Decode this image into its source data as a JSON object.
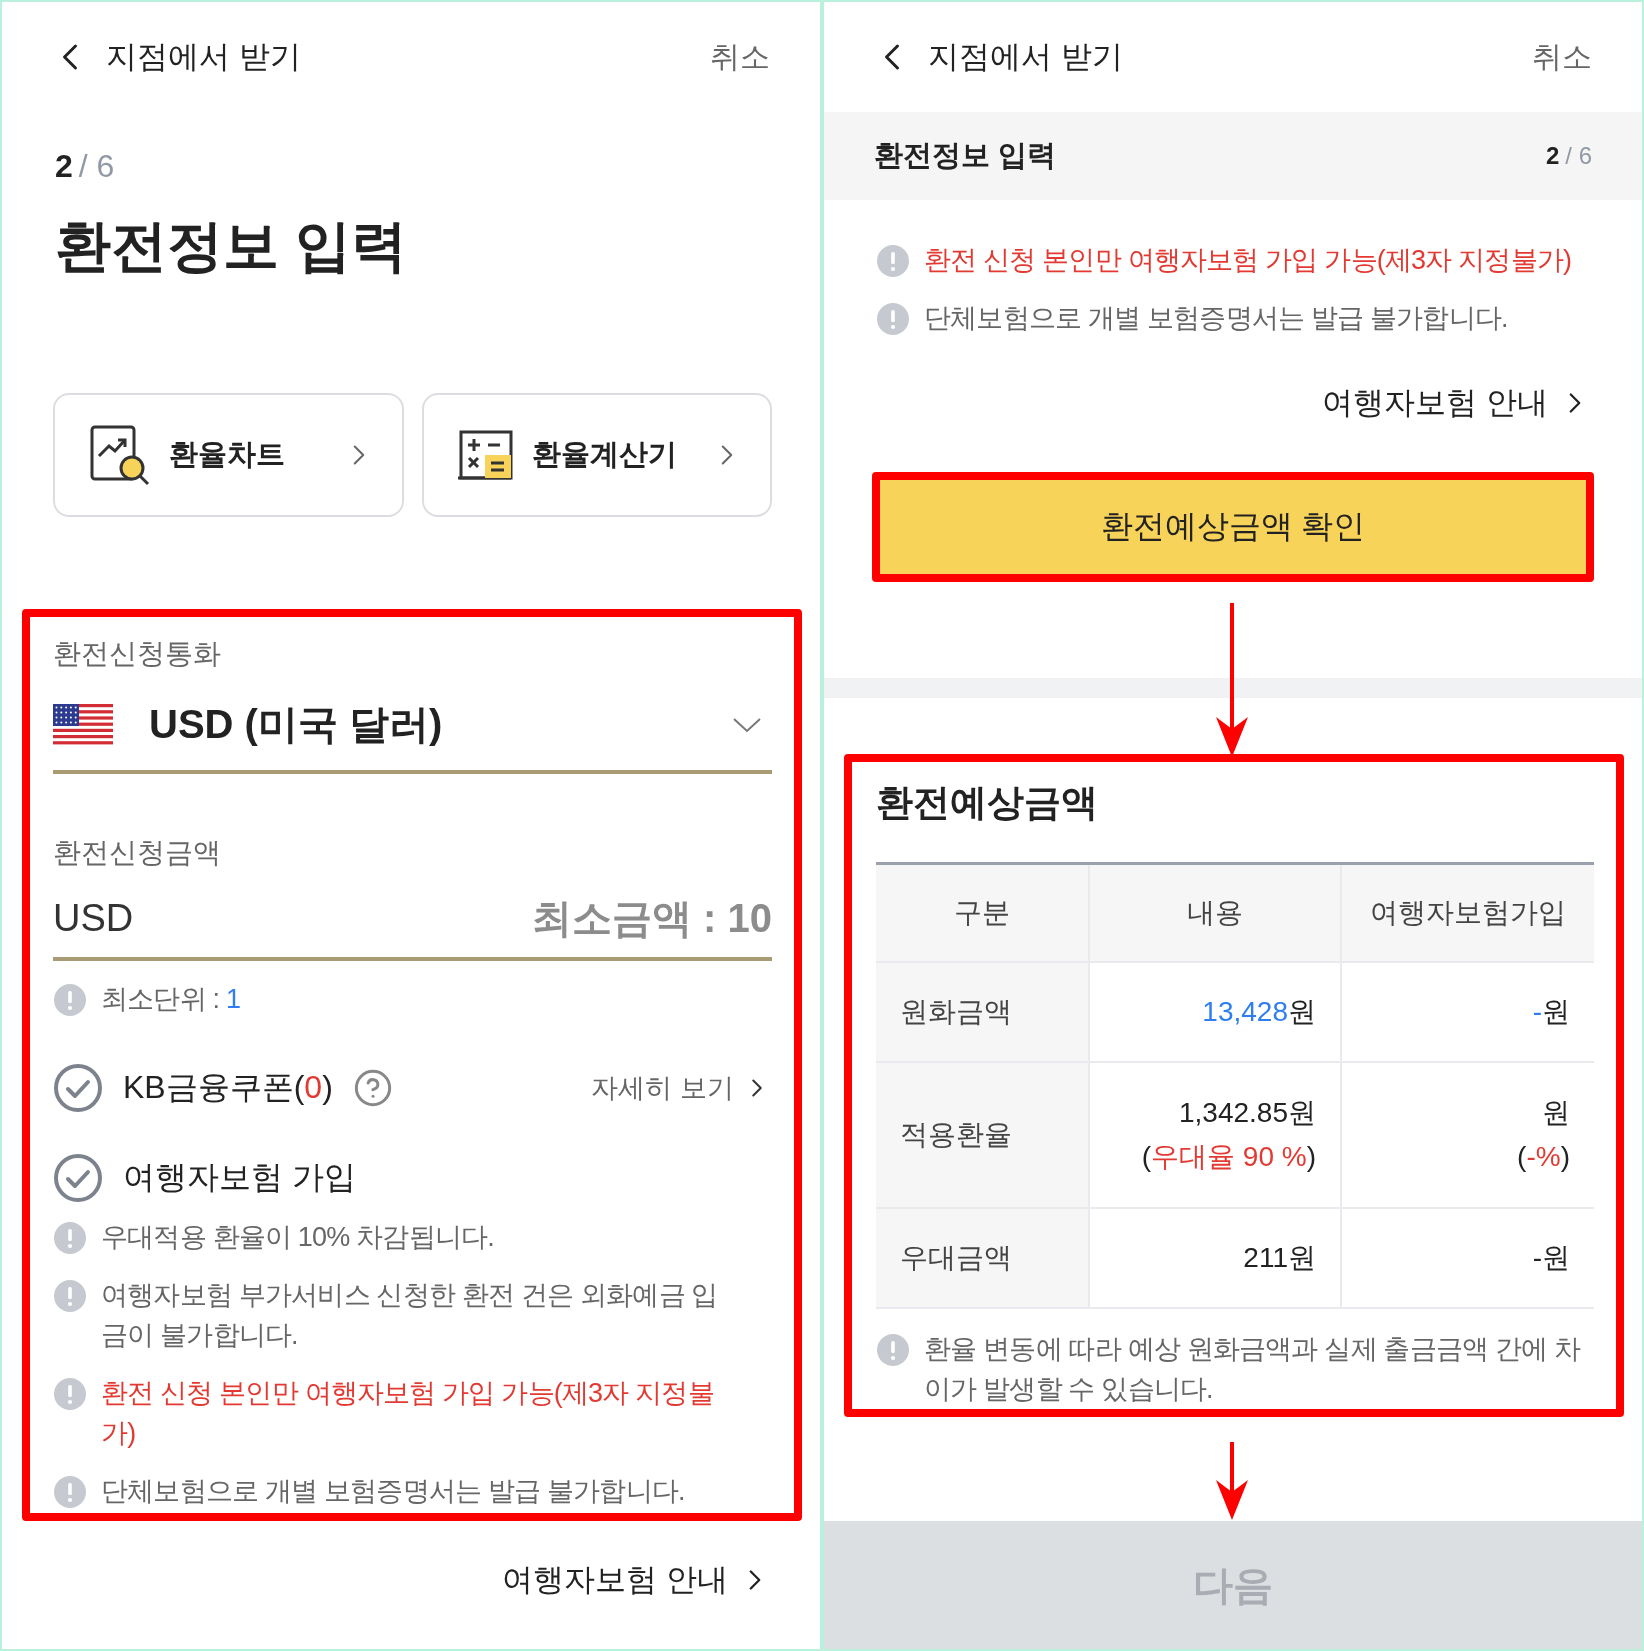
{
  "left_screen": {
    "header": {
      "title": "지점에서 받기",
      "cancel": "취소"
    },
    "step": {
      "current": "2",
      "total": "/ 6"
    },
    "title": "환전정보 입력",
    "shortcuts": [
      {
        "label": "환율차트",
        "kind": "chart"
      },
      {
        "label": "환율계산기",
        "kind": "calculator"
      }
    ],
    "currency": {
      "label": "환전신청통화",
      "value": "USD (미국 달러)"
    },
    "amount": {
      "label": "환전신청금액",
      "unit": "USD",
      "placeholder": "최소금액 : 10"
    },
    "min_unit": {
      "label": "최소단위 : ",
      "value": "1"
    },
    "coupon": {
      "label": "KB금융쿠폰(",
      "count": "0",
      "close": ")",
      "checked": false,
      "details": "자세히 보기"
    },
    "insurance": {
      "label": "여행자보험 가입",
      "checked": false
    },
    "notes": [
      {
        "text": "우대적용 환율이 10% 차감됩니다.",
        "kind": "plain"
      },
      {
        "text": "여행자보험 부가서비스 신청한 환전 건은 외화예금 입금이 불가합니다.",
        "kind": "plain"
      },
      {
        "text": "환전 신청 본인만 여행자보험 가입 가능(제3자 지정불가)",
        "kind": "alert"
      },
      {
        "text": "단체보험으로 개별 보험증명서는 발급 불가합니다.",
        "kind": "plain"
      }
    ],
    "guide_link": "여행자보험 안내"
  },
  "right_screen": {
    "header": {
      "title": "지점에서 받기",
      "cancel": "취소"
    },
    "sticky_bar": {
      "title": "환전정보 입력",
      "current": "2",
      "total": "/ 6"
    },
    "notes": [
      {
        "text": "환전 신청 본인만 여행자보험 가입 가능(제3자 지정불가)",
        "kind": "alert"
      },
      {
        "text": "단체보험으로 개별 보험증명서는 발급 불가합니다.",
        "kind": "plain"
      }
    ],
    "guide_link": "여행자보험 안내",
    "estimate_button": "환전예상금액 확인",
    "result": {
      "title": "환전예상금액",
      "columns": [
        "구분",
        "내용",
        "여행자보험가입"
      ],
      "rows": [
        [
          [
            [
              {
                "text": "원화금액"
              }
            ]
          ],
          [
            [
              {
                "text": "13,428",
                "color": "#2f7ef0"
              },
              {
                "text": "원"
              }
            ]
          ],
          [
            [
              {
                "text": "-",
                "color": "#2f7ef0"
              },
              {
                "text": "원"
              }
            ]
          ]
        ],
        [
          [
            [
              {
                "text": "적용환율"
              }
            ]
          ],
          [
            [
              {
                "text": "1,342.85"
              },
              {
                "text": "원"
              }
            ],
            [
              {
                "text": "("
              },
              {
                "text": "우대율 90 %",
                "color": "#e23a32"
              },
              {
                "text": ")"
              }
            ]
          ],
          [
            [
              {
                "text": "원"
              }
            ],
            [
              {
                "text": "("
              },
              {
                "text": "-%",
                "color": "#e23a32"
              },
              {
                "text": ")"
              }
            ]
          ]
        ],
        [
          [
            [
              {
                "text": "우대금액"
              }
            ]
          ],
          [
            [
              {
                "text": "211"
              },
              {
                "text": "원"
              }
            ]
          ],
          [
            [
              {
                "text": "-"
              },
              {
                "text": "원"
              }
            ]
          ]
        ]
      ],
      "note": "환율 변동에 따라 예상 원화금액과 실제 출금금액 간에 차이가 발생할 수 있습니다."
    },
    "next_button": {
      "label": "다음",
      "disabled": true
    }
  }
}
